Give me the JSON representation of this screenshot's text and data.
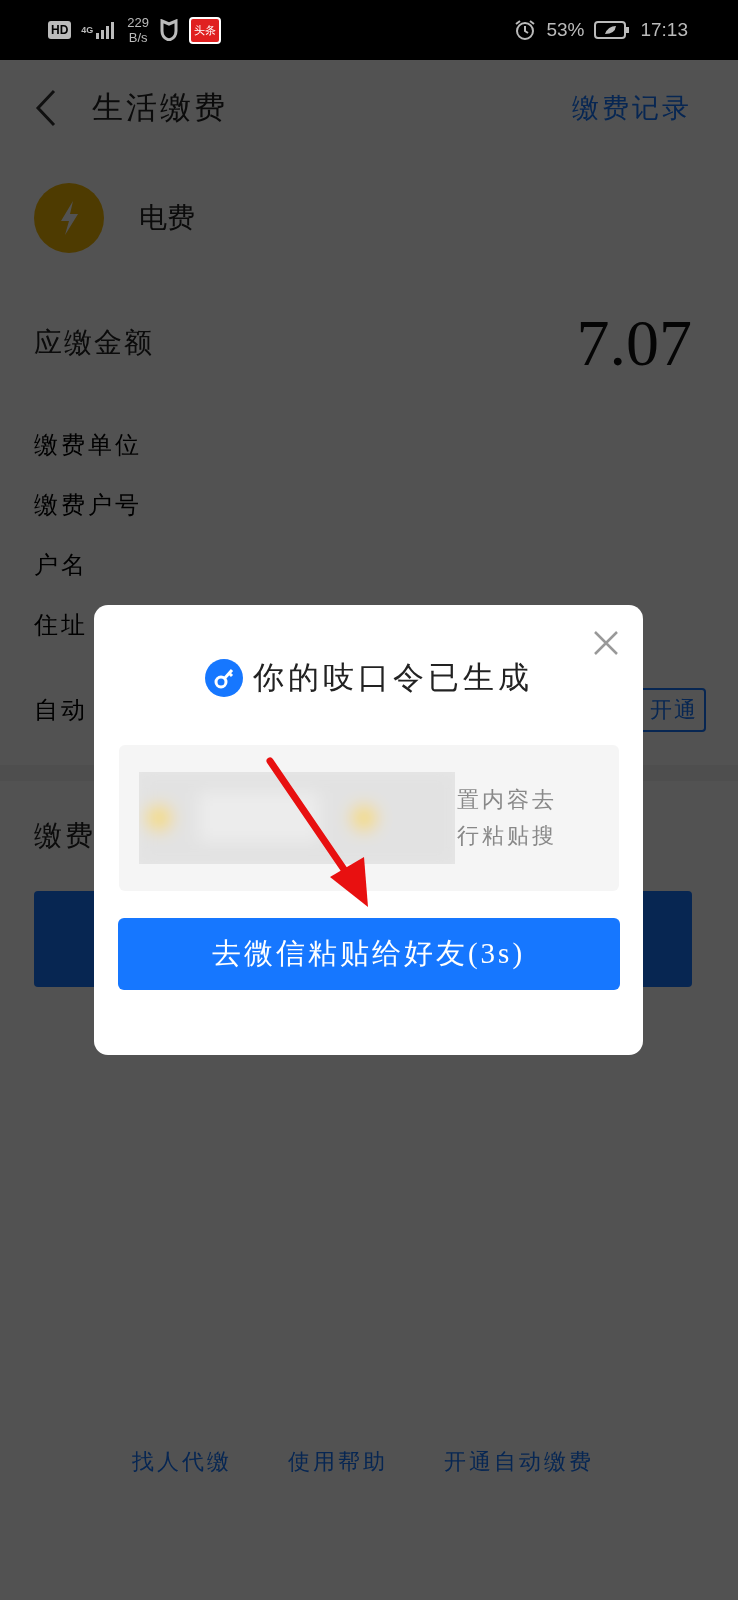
{
  "status_bar": {
    "hd": "HD",
    "network": "4G",
    "speed": [
      "229",
      "B/s"
    ],
    "app_badge": "头条",
    "battery": "53%",
    "time": "17:13"
  },
  "header": {
    "title": "生活缴费",
    "action": "缴费记录"
  },
  "bill": {
    "name": "电费"
  },
  "amount": {
    "label": "应缴金额",
    "value": "7.07"
  },
  "info_rows": [
    {
      "label": "缴费单位"
    },
    {
      "label": "缴费户号"
    },
    {
      "label": "户名"
    },
    {
      "label": "住址"
    },
    {
      "label": "自动",
      "button": "开通"
    }
  ],
  "section_label": "缴费",
  "links": [
    "找人代缴",
    "使用帮助",
    "开通自动缴费"
  ],
  "dialog": {
    "title": "你的吱口令已生成",
    "snippet": [
      "置内容去",
      "行粘贴搜"
    ],
    "button": "去微信粘贴给好友(3s)"
  }
}
